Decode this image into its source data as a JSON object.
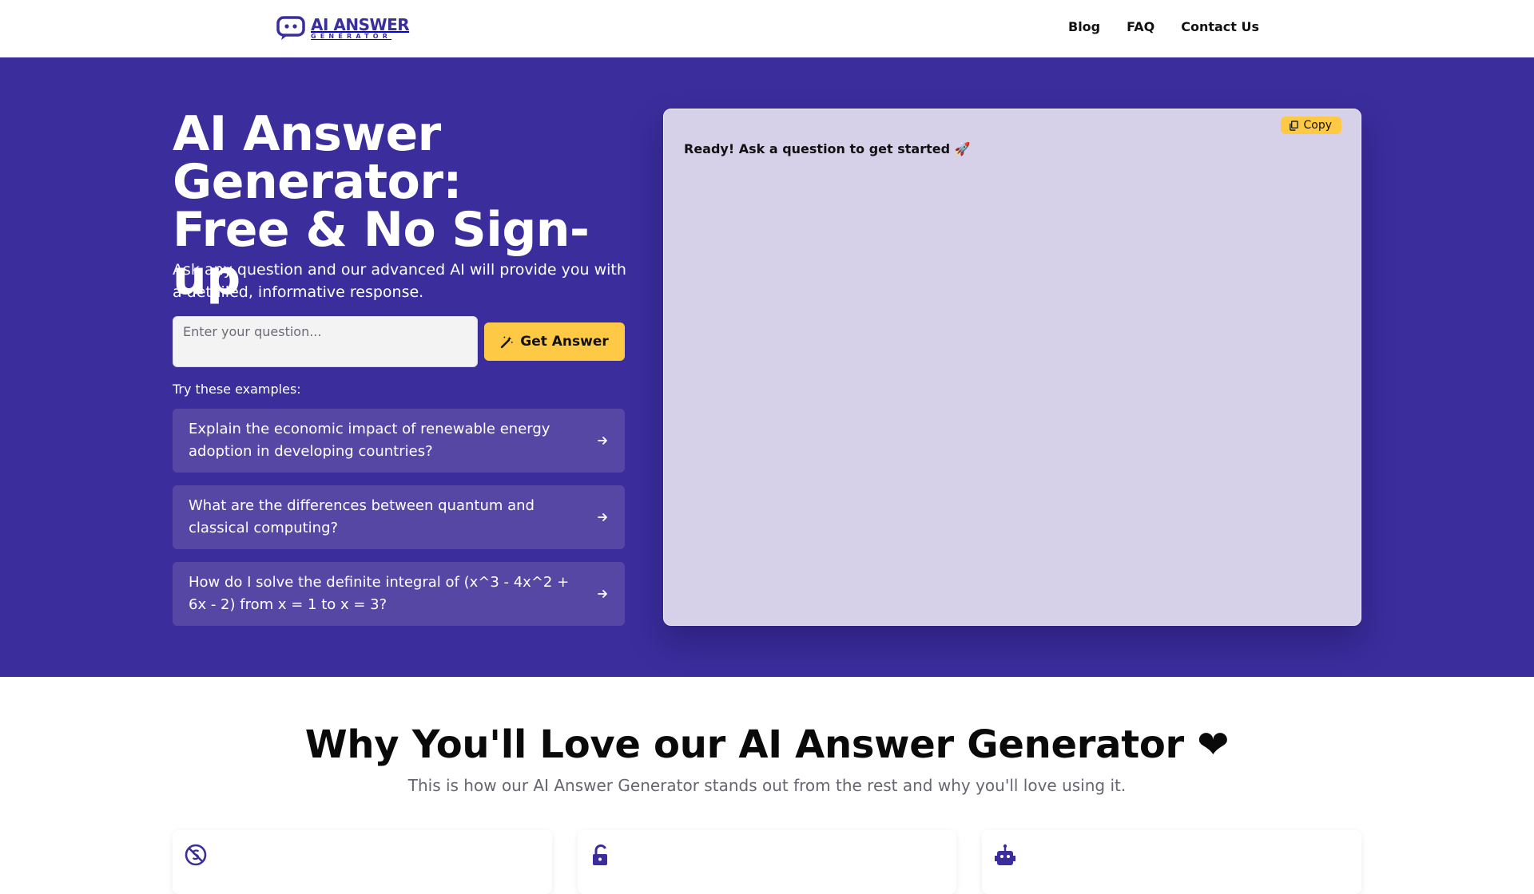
{
  "brand": {
    "logo_main": "AI ANSWER",
    "logo_sub": "GENERATOR",
    "accent": "#3b2d9c",
    "button_color": "#fec945"
  },
  "nav": {
    "items": [
      "Blog",
      "FAQ",
      "Contact Us"
    ]
  },
  "hero": {
    "title_line1": "AI Answer",
    "title_line2": "Generator:",
    "title_line3": "Free & No Sign-up",
    "subtitle": "Ask any question and our advanced AI will provide you with a detailed, informative response.",
    "input_placeholder": "Enter your question...",
    "input_value": "",
    "button_label": "Get Answer",
    "button_icon": "magic-wand-icon",
    "try_label": "Try these examples:",
    "examples": [
      "Explain the economic impact of renewable energy adoption in developing countries?",
      "What are the differences between quantum and classical computing?",
      "How do I solve the definite integral of (x^3 - 4x^2 + 6x - 2) from x = 1 to x = 3?"
    ]
  },
  "answer_panel": {
    "copy_label": "Copy",
    "copy_icon": "copy-icon",
    "status_text": "Ready! Ask a question to get started 🚀"
  },
  "features": {
    "title": "Why You'll Love our AI Answer Generator ❤",
    "subtitle": "This is how our AI Answer Generator stands out from the rest and why you'll love using it.",
    "card_icons": [
      "no-cost-icon",
      "unlock-icon",
      "robot-icon"
    ]
  }
}
